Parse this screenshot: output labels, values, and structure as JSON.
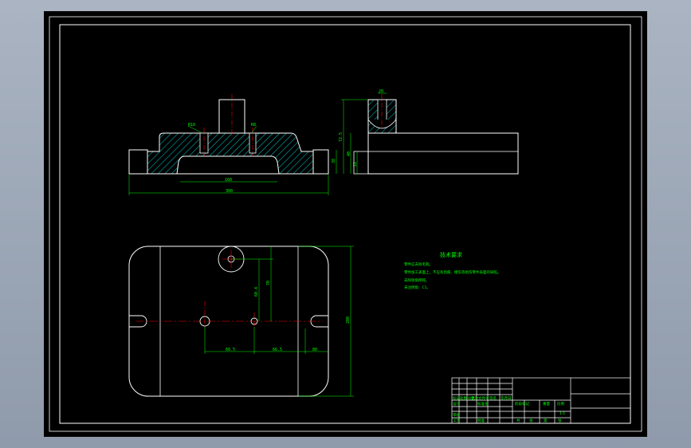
{
  "drawing": {
    "colors": {
      "background": "#000000",
      "outline": "#ffffff",
      "dimension": "#00ff00",
      "centerline": "#ff0000",
      "hatch": "#00ffff",
      "frame_outer": "#ffffff"
    },
    "front_view": {
      "dims": {
        "top_left": "R10",
        "top_right": "R8",
        "inner_width": "160",
        "overall_width": "300",
        "height_right": "38"
      }
    },
    "side_view": {
      "dims": {
        "slot_width": "20",
        "overall_height": "72.5",
        "mid_height": "40",
        "base_height": "28"
      }
    },
    "top_view": {
      "dims": {
        "vert_a": "60.4",
        "vert_b": "70",
        "overall_height": "200",
        "horiz_a": "60.5",
        "horiz_b": "66.5",
        "horiz_c": "80"
      }
    },
    "notes": {
      "title": "技术要求",
      "lines": [
        "零件应去除毛刺。",
        "零件加工表面上，不应有划痕、擦伤等损伤零件表面的缺陷。",
        "去除锐角倒钝。",
        "未注倒角：C1。"
      ]
    },
    "title_block": {
      "left_row_labels": [
        "标记",
        "处数",
        "分区",
        "更改文件号",
        "签名",
        "年月日"
      ],
      "design_row": [
        "设计",
        "标准化"
      ],
      "review_row": [
        "审核"
      ],
      "process_row": [
        "工艺",
        "批准"
      ],
      "mid_labels": [
        "阶段标记",
        "重量",
        "比例"
      ],
      "scale": "1:1",
      "sheet_labels": [
        "共",
        "张",
        "第",
        "张"
      ]
    }
  }
}
